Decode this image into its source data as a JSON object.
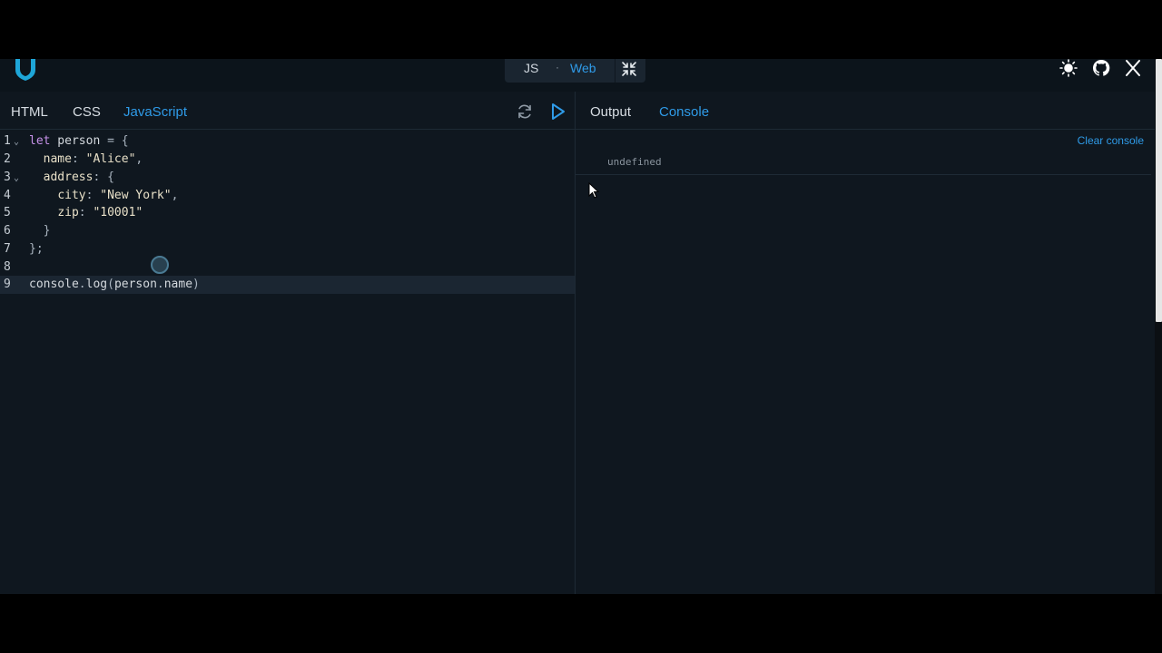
{
  "modes": {
    "js": "JS",
    "separator": "·",
    "web": "Web"
  },
  "editor_tabs": [
    {
      "label": "HTML",
      "active": false
    },
    {
      "label": "CSS",
      "active": false
    },
    {
      "label": "JavaScript",
      "active": true
    }
  ],
  "output_tabs": [
    {
      "label": "Output",
      "active": false
    },
    {
      "label": "Console",
      "active": true
    }
  ],
  "code": {
    "line_numbers": [
      "1",
      "2",
      "3",
      "4",
      "5",
      "6",
      "7",
      "8",
      "9"
    ],
    "current_line": 9
  },
  "console": {
    "clear_label": "Clear console",
    "entries": [
      "undefined"
    ]
  },
  "icons": {
    "logo": "shield-logo-icon",
    "expand": "collapse-arrows-icon",
    "theme": "sun-icon",
    "github": "github-icon",
    "x": "x-logo-icon",
    "refresh": "refresh-icon",
    "run": "play-icon"
  },
  "colors": {
    "accent": "#2f9be8",
    "background": "#0f171f",
    "keyword": "#c792ea"
  }
}
